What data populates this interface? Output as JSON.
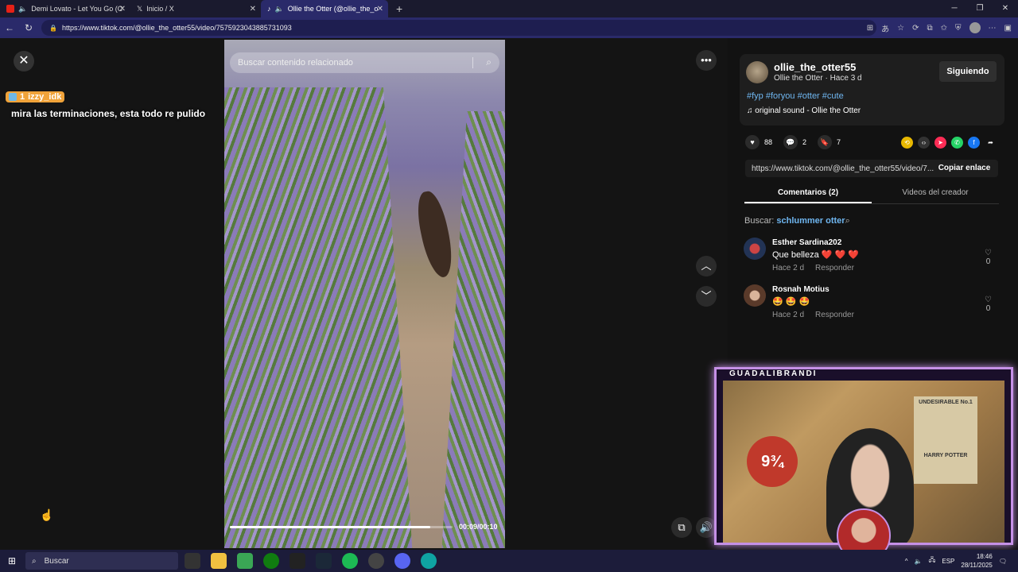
{
  "browser": {
    "tabs": [
      {
        "title": "Demi Lovato - Let You Go (C",
        "favicon_color": "#e62117"
      },
      {
        "title": "Inicio / X",
        "favicon_color": "#000000"
      },
      {
        "title": "Ollie the Otter (@ollie_the_o",
        "favicon_color": "#111111"
      }
    ],
    "url": "https://www.tiktok.com/@ollie_the_otter55/video/7575923043885731093"
  },
  "viewer": {
    "chat_user": "izzy_idk",
    "chat_badge_num": "1",
    "chat_message": "mira las terminaciones, esta todo re pulido",
    "search_placeholder": "Buscar contenido relacionado",
    "time": "00:09/00:10",
    "progress": 0.9
  },
  "post": {
    "username": "ollie_the_otter55",
    "subtitle": "Ollie the Otter · Hace 3 d",
    "follow_label": "Siguiendo",
    "tags": "#fyp #foryou #otter #cute",
    "sound": "original sound - Ollie the Otter",
    "likes": "88",
    "comments": "2",
    "saves": "7",
    "link": "https://www.tiktok.com/@ollie_the_otter55/video/7...",
    "copy_label": "Copiar enlace",
    "tab_comments": "Comentarios (2)",
    "tab_creator": "Videos del creador",
    "search_prefix": "Buscar:",
    "search_term": "schlummer otter"
  },
  "comments": [
    {
      "name": "Esther Sardina202",
      "text": "Que belleza ❤️ ❤️ ❤️",
      "time": "Hace 2 d",
      "reply": "Responder",
      "likes": "0"
    },
    {
      "name": "Rosnah Motius",
      "text": "🤩 🤩 🤩",
      "time": "Hace 2 d",
      "reply": "Responder",
      "likes": "0"
    }
  ],
  "webcam": {
    "label": "GUADALIBRANDI",
    "poster_title": "UNDESIRABLE No.1",
    "poster_name": "HARRY POTTER",
    "platform": "9¾"
  },
  "taskbar": {
    "search": "Buscar",
    "lang": "ESP",
    "time": "18:46",
    "date": "28/11/2025"
  }
}
